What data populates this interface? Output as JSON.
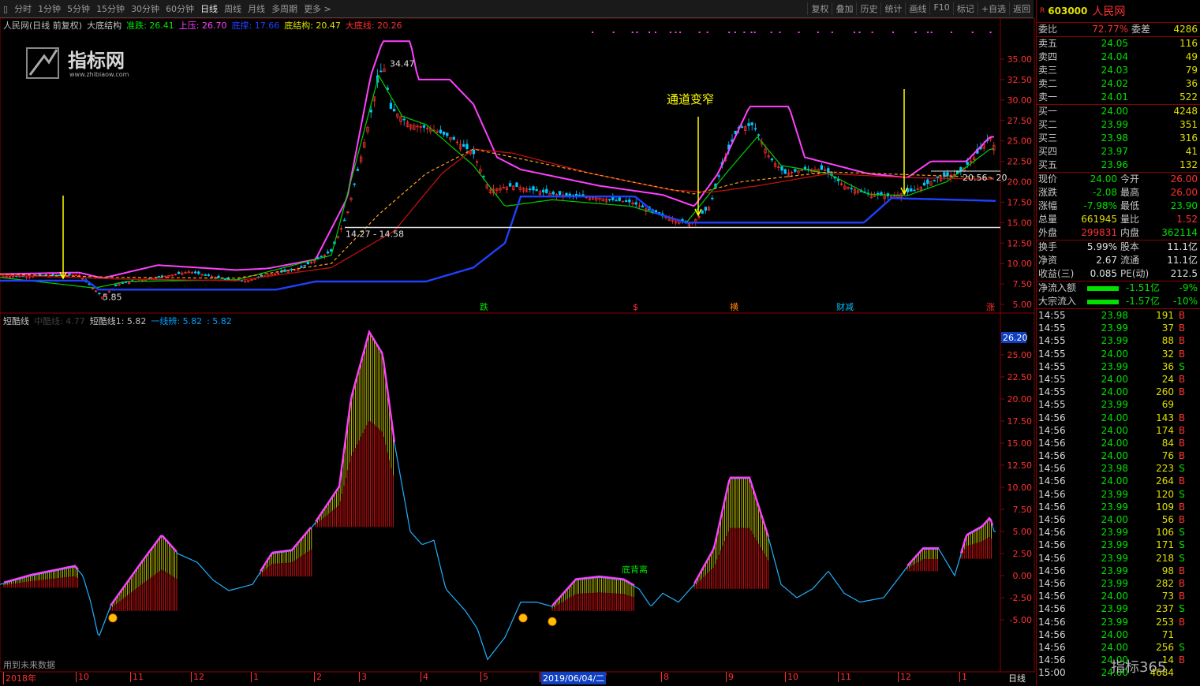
{
  "toolbar": {
    "left_items": [
      "分时",
      "1分钟",
      "5分钟",
      "15分钟",
      "30分钟",
      "60分钟",
      "日线",
      "周线",
      "月线",
      "多周期",
      "更多 >"
    ],
    "active_index": 6,
    "right_items": [
      "复权",
      "叠加",
      "历史",
      "统计",
      "画线",
      "F10",
      "标记",
      "+自选",
      "返回"
    ]
  },
  "main_chart": {
    "legend": [
      {
        "text": "人民网(日线 前复权)",
        "color": "#c0c0c0"
      },
      {
        "text": "大底结构",
        "color": "#c0c0c0"
      },
      {
        "text": "准跌: 26.41",
        "color": "#00e000"
      },
      {
        "text": "上压: 26.70",
        "color": "#ff40ff"
      },
      {
        "text": "底撑: 17.66",
        "color": "#2040ff"
      },
      {
        "text": "底结构: 20.47",
        "color": "#e0e000"
      },
      {
        "text": "大底线: 20.26",
        "color": "#ff3030"
      }
    ],
    "logo_text": "指标网",
    "logo_sub": "www.zhibiaow.com",
    "annotation": "通道变窄",
    "peak_label": "34.47",
    "low_label": "5.85",
    "range_label": "14.27 - 14.58",
    "right_label": "20.56 - 20",
    "bottom_markers": [
      {
        "text": "跌",
        "color": "#00e000"
      },
      {
        "text": "$",
        "color": "#ff3030"
      },
      {
        "text": "横",
        "color": "#ff8000"
      },
      {
        "text": "财减",
        "color": "#00c0ff"
      },
      {
        "text": "涨",
        "color": "#ff3030"
      }
    ],
    "y_ticks": [
      "35.00",
      "32.50",
      "30.00",
      "27.50",
      "25.00",
      "22.50",
      "20.00",
      "17.50",
      "15.00",
      "12.50",
      "10.00",
      "7.50",
      "5.00"
    ]
  },
  "sub_chart": {
    "legend": [
      {
        "text": "短酷线",
        "color": "#c0c0c0"
      },
      {
        "text": "中酷线: 4.77",
        "color": "#404040"
      },
      {
        "text": "短酷线1: 5.82",
        "color": "#c0c0c0"
      },
      {
        "text": "一线辨: 5.82",
        "color": "#00a0ff"
      },
      {
        "text": ": 5.82",
        "color": "#00a0ff"
      }
    ],
    "label_divergence": "底背离",
    "footer_note": "用到未来数据",
    "value_box": "26.20",
    "y_ticks": [
      "25.00",
      "22.50",
      "20.00",
      "17.50",
      "15.00",
      "12.50",
      "10.00",
      "7.50",
      "5.00",
      "2.50",
      "0.00",
      "-2.50",
      "-5.00"
    ]
  },
  "date_axis": {
    "labels": [
      "2018年",
      "10",
      "11",
      "12",
      "1",
      "2",
      "3",
      "4",
      "5",
      "6",
      "7",
      "8",
      "9",
      "10",
      "11",
      "12",
      "1"
    ],
    "highlight": "2019/06/04/二",
    "period": "日线"
  },
  "quote": {
    "code": "603000",
    "name": "人民网",
    "weibi_label": "委比",
    "weibi": "72.77%",
    "weicha_label": "委差",
    "weicha": "4286",
    "asks": [
      {
        "label": "卖五",
        "price": "24.05",
        "vol": "116"
      },
      {
        "label": "卖四",
        "price": "24.04",
        "vol": "49"
      },
      {
        "label": "卖三",
        "price": "24.03",
        "vol": "79"
      },
      {
        "label": "卖二",
        "price": "24.02",
        "vol": "36"
      },
      {
        "label": "卖一",
        "price": "24.01",
        "vol": "522"
      }
    ],
    "bids": [
      {
        "label": "买一",
        "price": "24.00",
        "vol": "4248"
      },
      {
        "label": "买二",
        "price": "23.99",
        "vol": "351"
      },
      {
        "label": "买三",
        "price": "23.98",
        "vol": "316"
      },
      {
        "label": "买四",
        "price": "23.97",
        "vol": "41"
      },
      {
        "label": "买五",
        "price": "23.96",
        "vol": "132"
      }
    ],
    "stats": [
      {
        "k": "现价",
        "v": "24.00",
        "vc": "#00e000",
        "k2": "今开",
        "v2": "26.00",
        "v2c": "#ff3030"
      },
      {
        "k": "涨跌",
        "v": "-2.08",
        "vc": "#00e000",
        "k2": "最高",
        "v2": "26.00",
        "v2c": "#ff3030"
      },
      {
        "k": "涨幅",
        "v": "-7.98%",
        "vc": "#00e000",
        "k2": "最低",
        "v2": "23.90",
        "v2c": "#00e000"
      },
      {
        "k": "总量",
        "v": "661945",
        "vc": "#e0e000",
        "k2": "量比",
        "v2": "1.52",
        "v2c": "#ff3030"
      },
      {
        "k": "外盘",
        "v": "299831",
        "vc": "#ff3030",
        "k2": "内盘",
        "v2": "362114",
        "v2c": "#00e000"
      }
    ],
    "stats2": [
      {
        "k": "换手",
        "v": "5.99%",
        "vc": "#e0e0e0",
        "k2": "股本",
        "v2": "11.1亿",
        "v2c": "#e0e0e0"
      },
      {
        "k": "净资",
        "v": "2.67",
        "vc": "#e0e0e0",
        "k2": "流通",
        "v2": "11.1亿",
        "v2c": "#e0e0e0"
      },
      {
        "k": "收益(三)",
        "v": "0.085",
        "vc": "#e0e0e0",
        "k2": "PE(动)",
        "v2": "212.5",
        "v2c": "#e0e0e0"
      }
    ],
    "flows": [
      {
        "k": "净流入额",
        "v": "-1.51亿",
        "p": "-9%"
      },
      {
        "k": "大宗流入",
        "v": "-1.57亿",
        "p": "-10%"
      }
    ],
    "ticks": [
      {
        "t": "14:55",
        "p": "23.98",
        "v": "191",
        "s": "B"
      },
      {
        "t": "14:55",
        "p": "23.99",
        "v": "37",
        "s": "B"
      },
      {
        "t": "14:55",
        "p": "23.99",
        "v": "88",
        "s": "B"
      },
      {
        "t": "14:55",
        "p": "24.00",
        "v": "32",
        "s": "B"
      },
      {
        "t": "14:55",
        "p": "23.99",
        "v": "36",
        "s": "S"
      },
      {
        "t": "14:55",
        "p": "24.00",
        "v": "24",
        "s": "B"
      },
      {
        "t": "14:55",
        "p": "24.00",
        "v": "260",
        "s": "B"
      },
      {
        "t": "14:55",
        "p": "23.99",
        "v": "69",
        "s": ""
      },
      {
        "t": "14:56",
        "p": "24.00",
        "v": "143",
        "s": "B"
      },
      {
        "t": "14:56",
        "p": "24.00",
        "v": "174",
        "s": "B"
      },
      {
        "t": "14:56",
        "p": "24.00",
        "v": "84",
        "s": "B"
      },
      {
        "t": "14:56",
        "p": "24.00",
        "v": "76",
        "s": "B"
      },
      {
        "t": "14:56",
        "p": "23.98",
        "v": "223",
        "s": "S"
      },
      {
        "t": "14:56",
        "p": "24.00",
        "v": "264",
        "s": "B"
      },
      {
        "t": "14:56",
        "p": "23.99",
        "v": "120",
        "s": "S"
      },
      {
        "t": "14:56",
        "p": "23.99",
        "v": "109",
        "s": "B"
      },
      {
        "t": "14:56",
        "p": "24.00",
        "v": "56",
        "s": "B"
      },
      {
        "t": "14:56",
        "p": "23.99",
        "v": "106",
        "s": "S"
      },
      {
        "t": "14:56",
        "p": "23.99",
        "v": "171",
        "s": "S"
      },
      {
        "t": "14:56",
        "p": "23.99",
        "v": "218",
        "s": "S"
      },
      {
        "t": "14:56",
        "p": "23.99",
        "v": "98",
        "s": "B"
      },
      {
        "t": "14:56",
        "p": "23.99",
        "v": "282",
        "s": "B"
      },
      {
        "t": "14:56",
        "p": "24.00",
        "v": "73",
        "s": "B"
      },
      {
        "t": "14:56",
        "p": "23.99",
        "v": "237",
        "s": "S"
      },
      {
        "t": "14:56",
        "p": "23.99",
        "v": "253",
        "s": "B"
      },
      {
        "t": "14:56",
        "p": "24.00",
        "v": "71",
        "s": ""
      },
      {
        "t": "14:56",
        "p": "24.00",
        "v": "256",
        "s": "S"
      },
      {
        "t": "14:56",
        "p": "24.00",
        "v": "14",
        "s": "B"
      },
      {
        "t": "15:00",
        "p": "24.00",
        "v": "4684",
        "s": ""
      }
    ]
  },
  "watermark": "指标365"
}
